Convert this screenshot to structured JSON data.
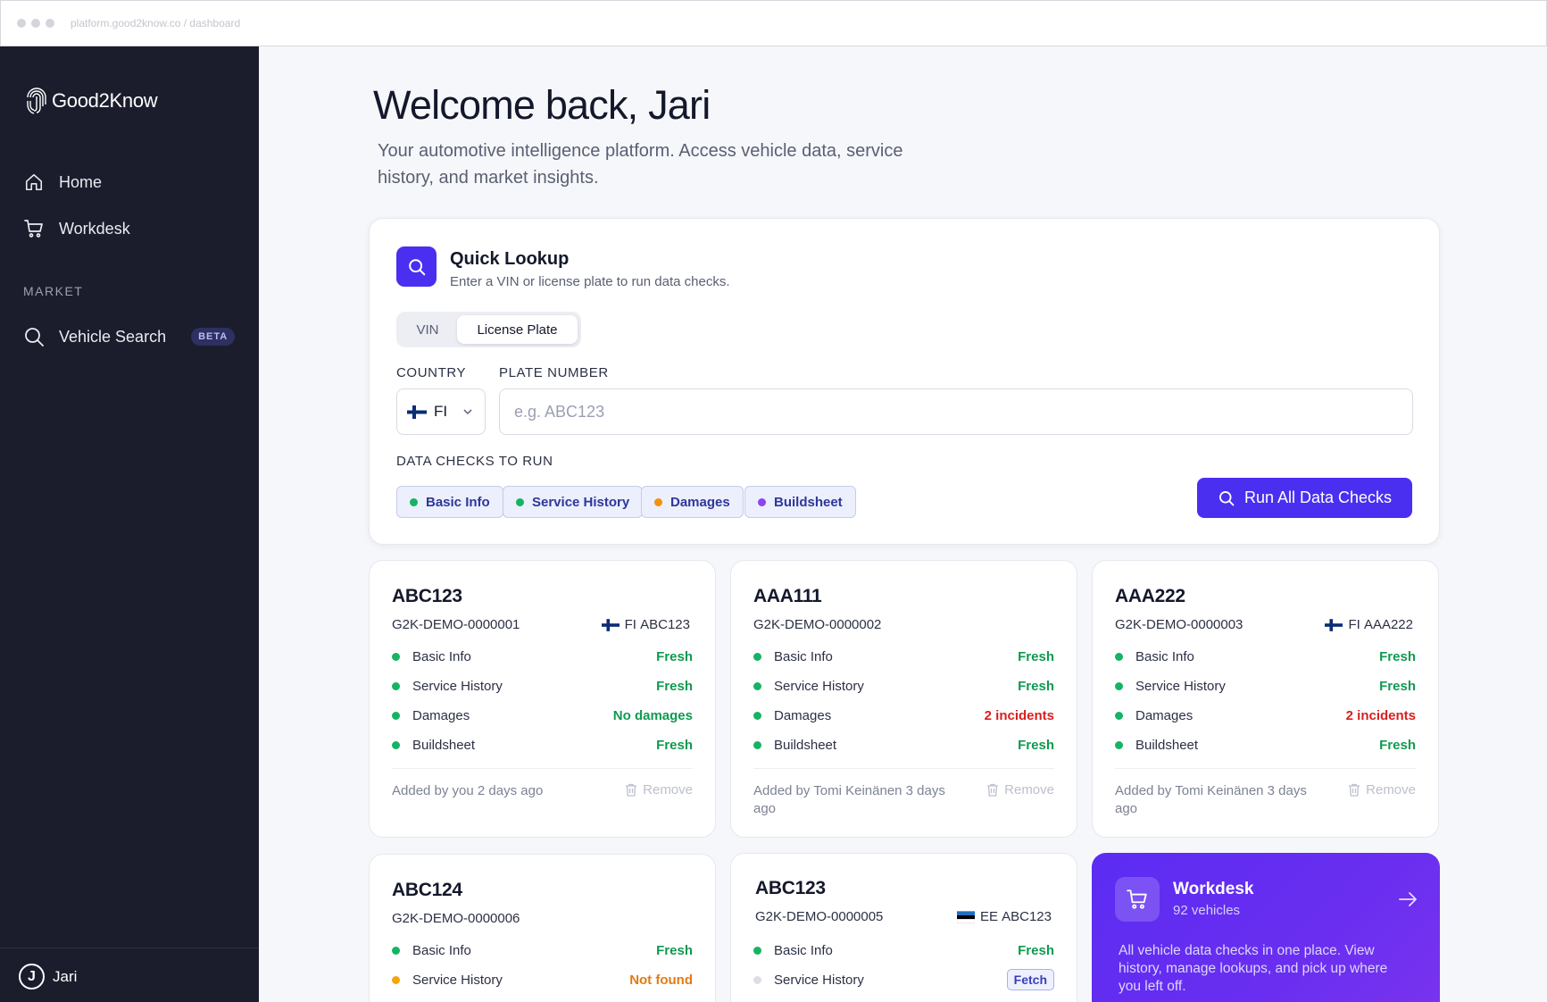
{
  "browser": {
    "url": "platform.good2know.co / dashboard"
  },
  "sidebar": {
    "brand": "Good2Know",
    "nav": [
      {
        "label": "Home",
        "icon": "home-icon"
      },
      {
        "label": "Workdesk",
        "icon": "cart-icon"
      }
    ],
    "section_label": "MARKET",
    "market_items": [
      {
        "label": "Vehicle Search",
        "icon": "search-icon",
        "badge": "BETA"
      }
    ],
    "user": {
      "initial": "J",
      "name": "Jari"
    }
  },
  "header": {
    "title": "Welcome back, Jari",
    "subtitle": "Your automotive intelligence platform. Access vehicle data, service history, and market insights."
  },
  "quick_lookup": {
    "title": "Quick Lookup",
    "description": "Enter a VIN or license plate to run data checks.",
    "modes": [
      "VIN",
      "License Plate"
    ],
    "active_mode": "License Plate",
    "country_label": "COUNTRY",
    "country_value": "FI",
    "plate_label": "PLATE NUMBER",
    "plate_placeholder": "e.g. ABC123",
    "plate_value": "",
    "checks_label": "DATA CHECKS TO RUN",
    "checks": [
      {
        "label": "Basic Info",
        "color": "#16b364"
      },
      {
        "label": "Service History",
        "color": "#16b364"
      },
      {
        "label": "Damages",
        "color": "#f2910f"
      },
      {
        "label": "Buildsheet",
        "color": "#8b46f0"
      }
    ],
    "run_button": "Run All Data Checks",
    "accent": "#4a2ff0"
  },
  "vehicles": [
    {
      "plate": "ABC123",
      "id": "G2K-DEMO-0000001",
      "country": "FI",
      "reg": "ABC123",
      "checks": [
        {
          "label": "Basic Info",
          "status": "Fresh",
          "tone": "green"
        },
        {
          "label": "Service History",
          "status": "Fresh",
          "tone": "green"
        },
        {
          "label": "Damages",
          "status": "No damages",
          "tone": "green"
        },
        {
          "label": "Buildsheet",
          "status": "Fresh",
          "tone": "green"
        }
      ],
      "added": "Added by you 2 days ago",
      "remove": "Remove"
    },
    {
      "plate": "AAA111",
      "id": "G2K-DEMO-0000002",
      "country": "",
      "reg": "",
      "checks": [
        {
          "label": "Basic Info",
          "status": "Fresh",
          "tone": "green"
        },
        {
          "label": "Service History",
          "status": "Fresh",
          "tone": "green"
        },
        {
          "label": "Damages",
          "status": "2 incidents",
          "tone": "red"
        },
        {
          "label": "Buildsheet",
          "status": "Fresh",
          "tone": "green"
        }
      ],
      "added": "Added by Tomi Keinänen 3 days ago",
      "remove": "Remove"
    },
    {
      "plate": "AAA222",
      "id": "G2K-DEMO-0000003",
      "country": "FI",
      "reg": "AAA222",
      "checks": [
        {
          "label": "Basic Info",
          "status": "Fresh",
          "tone": "green"
        },
        {
          "label": "Service History",
          "status": "Fresh",
          "tone": "green"
        },
        {
          "label": "Damages",
          "status": "2 incidents",
          "tone": "red"
        },
        {
          "label": "Buildsheet",
          "status": "Fresh",
          "tone": "green"
        }
      ],
      "added": "Added by Tomi Keinänen 3 days ago",
      "remove": "Remove"
    },
    {
      "plate": "ABC124",
      "id": "G2K-DEMO-0000006",
      "country": "",
      "reg": "",
      "checks": [
        {
          "label": "Basic Info",
          "status": "Fresh",
          "tone": "green"
        },
        {
          "label": "Service History",
          "status": "Not found",
          "tone": "orange"
        }
      ]
    },
    {
      "plate": "ABC123",
      "id": "G2K-DEMO-0000005",
      "country": "EE",
      "reg": "ABC123",
      "checks": [
        {
          "label": "Basic Info",
          "status": "Fresh",
          "tone": "green"
        },
        {
          "label": "Service History",
          "status": "Fetch",
          "tone": "fetch"
        }
      ]
    }
  ],
  "workdesk_promo": {
    "title": "Workdesk",
    "count": "92 vehicles",
    "description": "All vehicle data checks in one place. View history, manage lookups, and pick up where you left off."
  }
}
